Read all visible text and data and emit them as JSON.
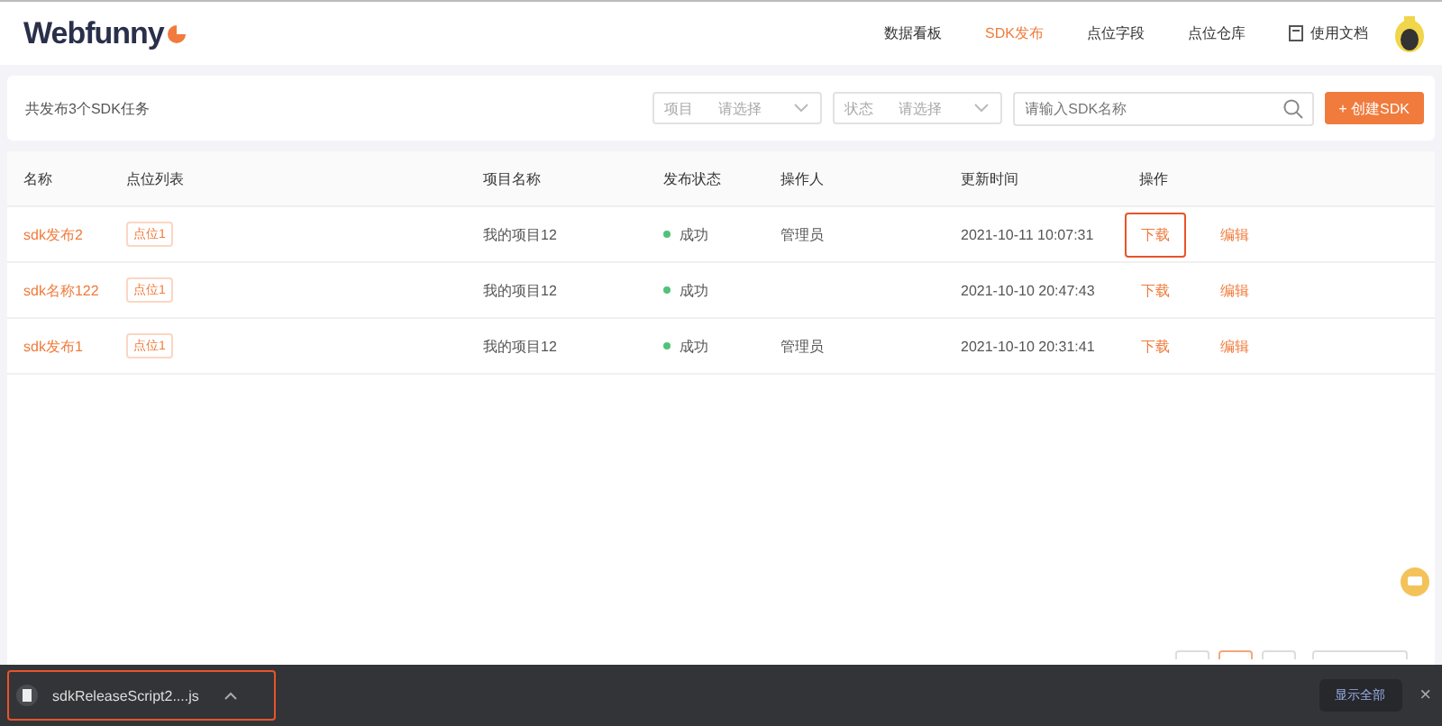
{
  "header": {
    "logo": "Webfunny",
    "nav": [
      {
        "label": "数据看板",
        "selected": false
      },
      {
        "label": "SDK发布",
        "selected": true
      },
      {
        "label": "点位字段",
        "selected": false
      },
      {
        "label": "点位仓库",
        "selected": false
      }
    ],
    "docs": "使用文档"
  },
  "toolbar": {
    "summary": "共发布3个SDK任务",
    "filters": [
      {
        "label": "项目",
        "placeholder": "请选择"
      },
      {
        "label": "状态",
        "placeholder": "请选择"
      }
    ],
    "search": {
      "placeholder": "请输入SDK名称"
    },
    "create_button": "+ 创建SDK"
  },
  "table": {
    "columns": [
      "名称",
      "点位列表",
      "项目名称",
      "发布状态",
      "操作人",
      "更新时间",
      "操作"
    ],
    "rows": [
      {
        "name": "sdk发布2",
        "points": [
          "点位1"
        ],
        "project": "我的项目12",
        "status": "成功",
        "operator": "管理员",
        "updated": "2021-10-11 10:07:31",
        "actions": [
          {
            "label": "下载",
            "highlighted": true
          },
          {
            "label": "编辑",
            "highlighted": false
          }
        ]
      },
      {
        "name": "sdk名称122",
        "points": [
          "点位1"
        ],
        "project": "我的项目12",
        "status": "成功",
        "updated": "2021-10-10 20:47:43",
        "actions": [
          {
            "label": "下载",
            "highlighted": false
          },
          {
            "label": "编辑",
            "highlighted": false
          }
        ]
      },
      {
        "name": "sdk发布1",
        "points": [
          "点位1"
        ],
        "project": "我的项目12",
        "status": "成功",
        "operator": "管理员",
        "updated": "2021-10-10 20:31:41",
        "actions": [
          {
            "label": "下载",
            "highlighted": false
          },
          {
            "label": "编辑",
            "highlighted": false
          }
        ]
      }
    ]
  },
  "pagination": [
    {
      "selected": false
    },
    {
      "selected": true
    },
    {
      "selected": false
    }
  ],
  "download_bar": {
    "file": "sdkReleaseScript2....js",
    "highlighted": true,
    "show_all": "显示全部",
    "close": "×"
  }
}
